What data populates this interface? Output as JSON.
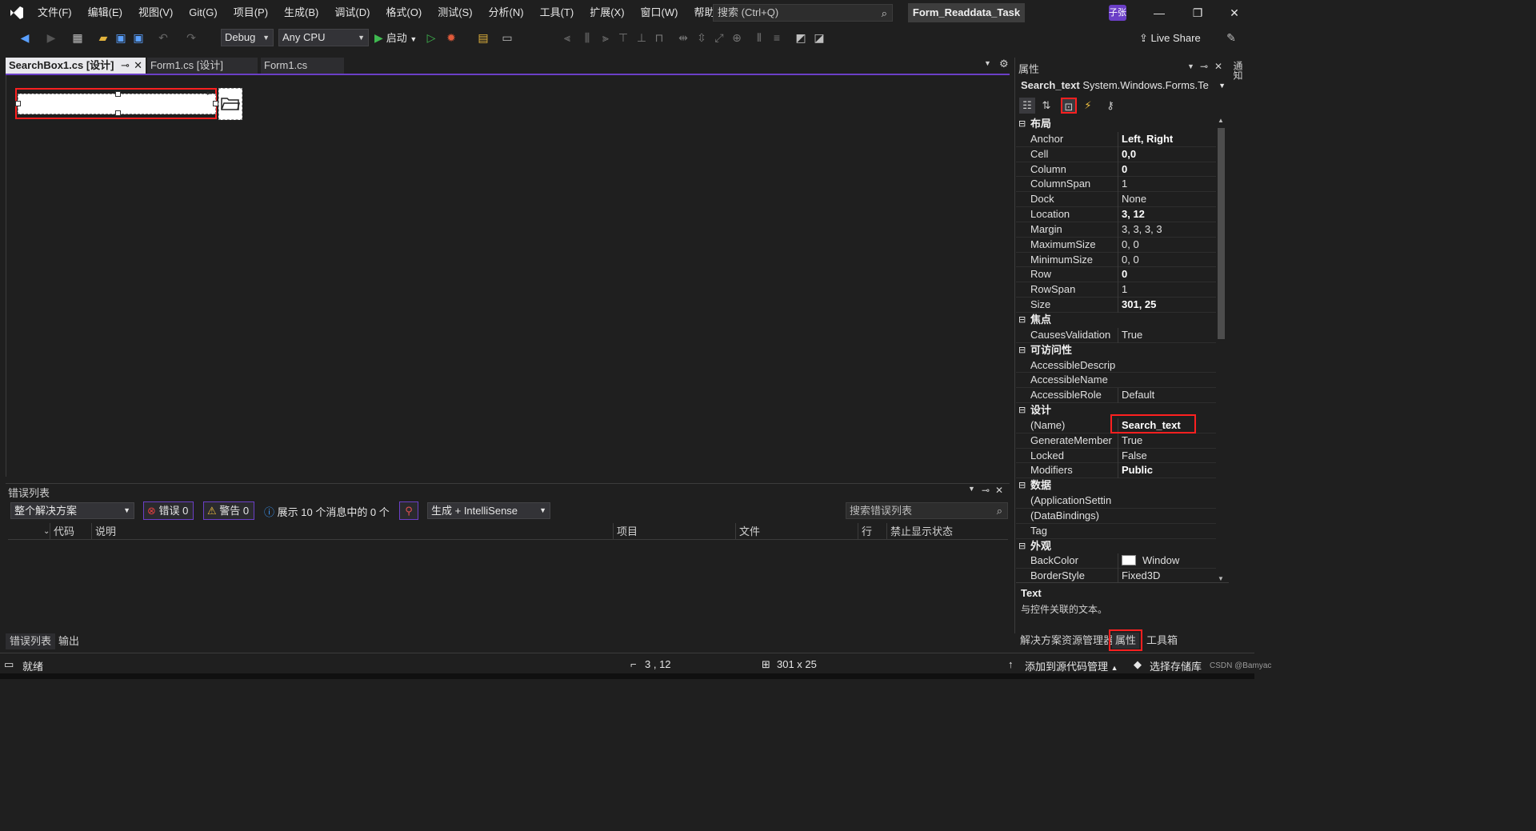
{
  "menu": {
    "items": [
      "文件(F)",
      "编辑(E)",
      "视图(V)",
      "Git(G)",
      "项目(P)",
      "生成(B)",
      "调试(D)",
      "格式(O)",
      "测试(S)",
      "分析(N)",
      "工具(T)",
      "扩展(X)",
      "窗口(W)",
      "帮助(H)"
    ],
    "search_placeholder": "搜索 (Ctrl+Q)",
    "solution_title": "Form_Readdata_Task",
    "user_initials": "子张"
  },
  "toolbar": {
    "config": "Debug",
    "platform": "Any CPU",
    "start_label": "启动",
    "live_share": "Live Share"
  },
  "doc_tabs": [
    {
      "label": "SearchBox1.cs [设计]",
      "active": true
    },
    {
      "label": "Form1.cs [设计]",
      "active": false
    },
    {
      "label": "Form1.cs",
      "active": false
    }
  ],
  "error_list": {
    "title": "错误列表",
    "scope": "整个解决方案",
    "errors_label": "错误 0",
    "warnings_label": "警告 0",
    "messages_label": "展示 10 个消息中的 0 个",
    "build_filter": "生成 + IntelliSense",
    "search_placeholder": "搜索错误列表",
    "columns": [
      "代码",
      "说明",
      "项目",
      "文件",
      "行",
      "禁止显示状态"
    ],
    "bottom_tabs": [
      "错误列表",
      "输出"
    ]
  },
  "properties": {
    "title": "属性",
    "object_name": "Search_text",
    "object_type": "System.Windows.Forms.Te",
    "rows": [
      {
        "kind": "cat",
        "label": "布局"
      },
      {
        "kind": "item",
        "name": "Anchor",
        "value": "Left, Right",
        "bold": true,
        "expandable": false
      },
      {
        "kind": "item",
        "name": "Cell",
        "value": "0,0",
        "bold": true,
        "expandable": true
      },
      {
        "kind": "item",
        "name": "Column",
        "value": "0",
        "bold": true,
        "expandable": false
      },
      {
        "kind": "item",
        "name": "ColumnSpan",
        "value": "1",
        "bold": false,
        "expandable": false
      },
      {
        "kind": "item",
        "name": "Dock",
        "value": "None",
        "bold": false,
        "expandable": false
      },
      {
        "kind": "item",
        "name": "Location",
        "value": "3, 12",
        "bold": true,
        "expandable": true
      },
      {
        "kind": "item",
        "name": "Margin",
        "value": "3, 3, 3, 3",
        "bold": false,
        "expandable": true
      },
      {
        "kind": "item",
        "name": "MaximumSize",
        "value": "0, 0",
        "bold": false,
        "expandable": true
      },
      {
        "kind": "item",
        "name": "MinimumSize",
        "value": "0, 0",
        "bold": false,
        "expandable": true
      },
      {
        "kind": "item",
        "name": "Row",
        "value": "0",
        "bold": true,
        "expandable": false
      },
      {
        "kind": "item",
        "name": "RowSpan",
        "value": "1",
        "bold": false,
        "expandable": false
      },
      {
        "kind": "item",
        "name": "Size",
        "value": "301, 25",
        "bold": true,
        "expandable": true
      },
      {
        "kind": "cat",
        "label": "焦点"
      },
      {
        "kind": "item",
        "name": "CausesValidation",
        "value": "True",
        "bold": false,
        "expandable": false
      },
      {
        "kind": "cat",
        "label": "可访问性"
      },
      {
        "kind": "item",
        "name": "AccessibleDescrip",
        "value": "",
        "bold": false,
        "expandable": false
      },
      {
        "kind": "item",
        "name": "AccessibleName",
        "value": "",
        "bold": false,
        "expandable": false
      },
      {
        "kind": "item",
        "name": "AccessibleRole",
        "value": "Default",
        "bold": false,
        "expandable": false
      },
      {
        "kind": "cat",
        "label": "设计"
      },
      {
        "kind": "item",
        "name": "(Name)",
        "value": "Search_text",
        "bold": true,
        "expandable": false
      },
      {
        "kind": "item",
        "name": "GenerateMember",
        "value": "True",
        "bold": false,
        "expandable": false
      },
      {
        "kind": "item",
        "name": "Locked",
        "value": "False",
        "bold": false,
        "expandable": false
      },
      {
        "kind": "item",
        "name": "Modifiers",
        "value": "Public",
        "bold": true,
        "expandable": false
      },
      {
        "kind": "cat",
        "label": "数据"
      },
      {
        "kind": "item",
        "name": "(ApplicationSettin",
        "value": "",
        "bold": false,
        "expandable": true
      },
      {
        "kind": "item",
        "name": "(DataBindings)",
        "value": "",
        "bold": false,
        "expandable": true
      },
      {
        "kind": "item",
        "name": "Tag",
        "value": "",
        "bold": false,
        "expandable": false
      },
      {
        "kind": "cat",
        "label": "外观"
      },
      {
        "kind": "item",
        "name": "BackColor",
        "value": "Window",
        "bold": false,
        "expandable": false,
        "swatch": "#ffffff"
      },
      {
        "kind": "item",
        "name": "BorderStyle",
        "value": "Fixed3D",
        "bold": false,
        "expandable": false
      }
    ],
    "desc_title": "Text",
    "desc_text": "与控件关联的文本。",
    "vertical_tab": "通知"
  },
  "right_tabs": [
    "解决方案资源管理器",
    "属性",
    "工具箱"
  ],
  "status": {
    "ready": "就绪",
    "location": "3 , 12",
    "size": "301 x 25",
    "add_source": "添加到源代码管理",
    "select_repo": "选择存储库",
    "watermark": "CSDN @Bamyac"
  },
  "colors": {
    "accent": "#6b3fc7",
    "highlight": "#ff2020"
  }
}
